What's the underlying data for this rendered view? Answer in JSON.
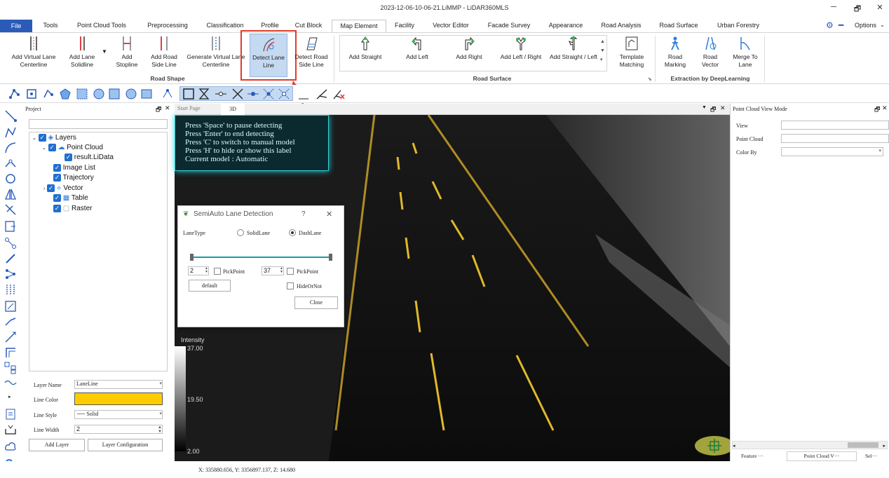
{
  "window": {
    "title": "2023-12-06-10-06-21.LiMMP - LiDAR360MLS",
    "minimize": "─",
    "restore": "🗗",
    "close": "✕"
  },
  "tabs": {
    "file": "File",
    "items": [
      "Tools",
      "Point Cloud Tools",
      "Preprocessing",
      "Classification",
      "Profile",
      "Cut Block",
      "Map Element",
      "Facility",
      "Vector Editor",
      "Facade Survey",
      "Appearance",
      "Road Analysis",
      "Road Surface",
      "Urban Forestry"
    ],
    "active": "Map Element",
    "options": "Options"
  },
  "ribbon": {
    "road_shape": [
      "Add Virtual Lane Centerline",
      "Add Lane Solidline",
      "Add Stopline",
      "Add Road Side Line",
      "Generate Virtual Lane Centerline",
      "Detect Lane Line",
      "Detect Road Side Line"
    ],
    "road_shape_label": "Road Shape",
    "road_surface": [
      "Add Straight",
      "Add Left",
      "Add Right",
      "Add Left / Right",
      "Add Straight / Left"
    ],
    "template": "Template Matching",
    "road_surface_label": "Road Surface",
    "deep": [
      "Road Marking",
      "Road Vector",
      "Merge To Lane"
    ],
    "deep_label": "Extraction by DeepLearning"
  },
  "project": {
    "title": "Project",
    "layers": "Layers",
    "point_cloud": "Point Cloud",
    "lidata": "result.LiData",
    "image_list": "Image List",
    "trajectory": "Trajectory",
    "vector": "Vector",
    "table": "Table",
    "raster": "Raster"
  },
  "layer_props": {
    "layer_name_label": "Layer Name",
    "layer_name": "LaneLine",
    "line_color_label": "Line Color",
    "line_color": "#ffcc00",
    "line_style_label": "Line Style",
    "line_style": "Solid",
    "line_width_label": "Line Width",
    "line_width": "2",
    "add_layer": "Add Layer",
    "layer_config": "Layer Configuration"
  },
  "viewer": {
    "tab_start": "Start Page",
    "tab_3d": "3D",
    "hints": [
      "Press 'Space' to pause detecting",
      "Press 'Enter' to end detecting",
      "Press 'C' to switch to manual model",
      "Press 'H' to hide or show this label",
      "Current model : Automatic"
    ],
    "intensity_label": "Intensity",
    "intensity_max": "37.00",
    "intensity_mid": "19.50",
    "intensity_min": "2.00"
  },
  "dialog": {
    "title": "SemiAuto Lane Detection",
    "help": "?",
    "close_x": "✕",
    "lane_type": "LaneType",
    "solid": "SolidLane",
    "dash": "DashLane",
    "left_val": "2",
    "right_val": "37",
    "pickpoint1": "PickPoint",
    "pickpoint2": "PickPoint",
    "default_btn": "default",
    "hide": "HideOrNot",
    "close_btn": "Close"
  },
  "right_panel": {
    "title": "Point Cloud View Mode",
    "view": "View",
    "point_cloud": "Point Cloud",
    "color_by": "Color By",
    "tabs": [
      "Feature ···",
      "Point Cloud V···",
      "Sel···"
    ]
  },
  "status": {
    "coords": "X: 335880.656, Y: 3356897.137, Z: 14.680"
  }
}
